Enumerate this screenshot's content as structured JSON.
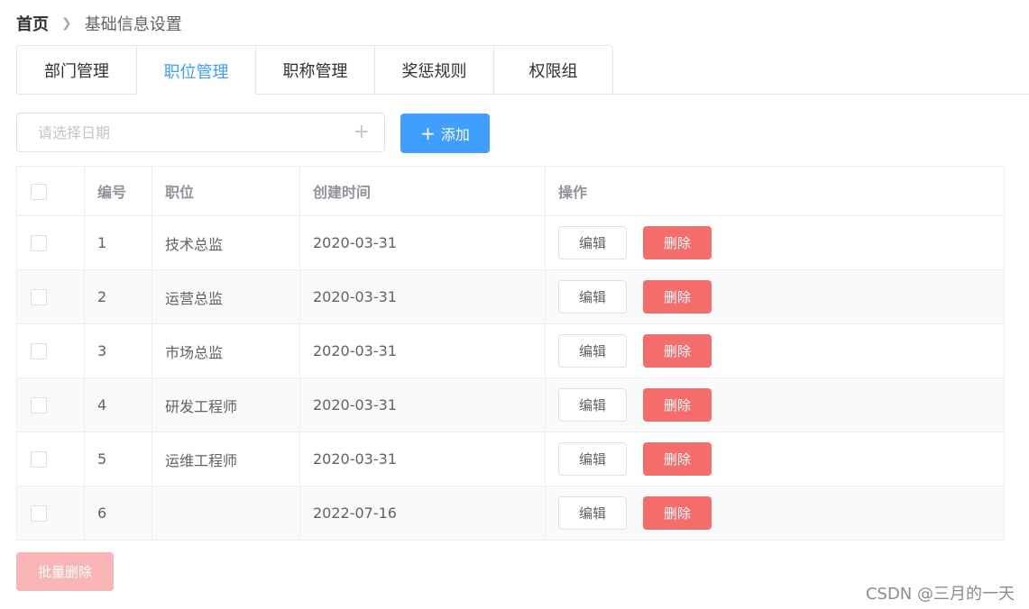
{
  "breadcrumb": {
    "home": "首页",
    "separator": ">",
    "current": "基础信息设置"
  },
  "tabs": [
    {
      "label": "部门管理",
      "active": false
    },
    {
      "label": "职位管理",
      "active": true
    },
    {
      "label": "职称管理",
      "active": false
    },
    {
      "label": "奖惩规则",
      "active": false
    },
    {
      "label": "权限组",
      "active": false
    }
  ],
  "toolbar": {
    "date_placeholder": "请选择日期",
    "date_value": "",
    "add_label": "添加"
  },
  "table": {
    "headers": {
      "number": "编号",
      "position": "职位",
      "created": "创建时间",
      "actions": "操作"
    },
    "rows": [
      {
        "id": "1",
        "position": "技术总监",
        "created": "2020-03-31"
      },
      {
        "id": "2",
        "position": "运营总监",
        "created": "2020-03-31"
      },
      {
        "id": "3",
        "position": "市场总监",
        "created": "2020-03-31"
      },
      {
        "id": "4",
        "position": "研发工程师",
        "created": "2020-03-31"
      },
      {
        "id": "5",
        "position": "运维工程师",
        "created": "2020-03-31"
      },
      {
        "id": "6",
        "position": "",
        "created": "2022-07-16"
      }
    ],
    "edit_label": "编辑",
    "delete_label": "删除"
  },
  "batch_delete_label": "批量删除",
  "watermark": "CSDN @三月的一天",
  "colors": {
    "primary": "#409eff",
    "danger": "#f56c6c",
    "danger_disabled": "#fab6b6"
  }
}
